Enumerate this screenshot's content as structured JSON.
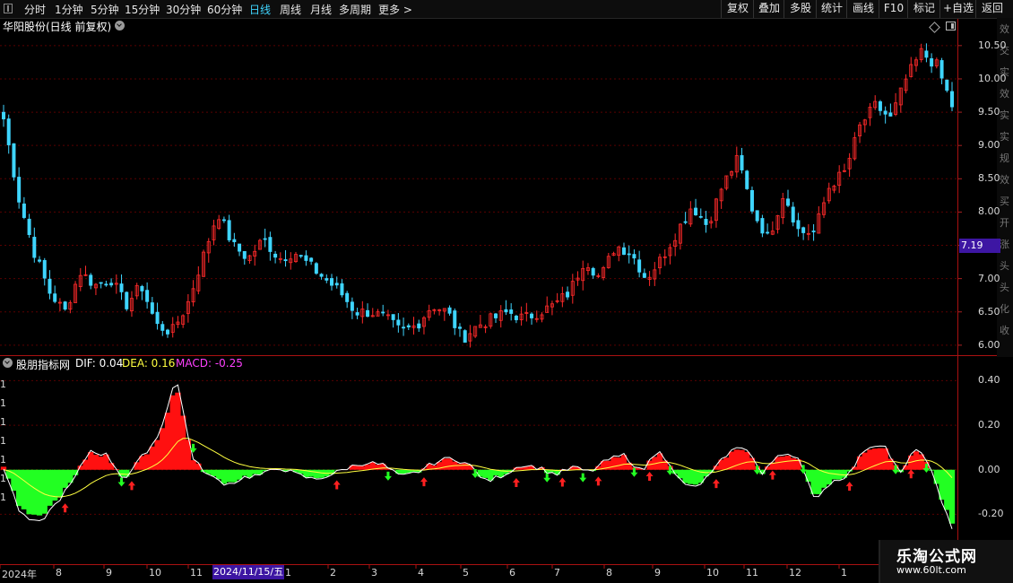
{
  "toolbar": {
    "periods": [
      "分时",
      "1分钟",
      "5分钟",
      "15分钟",
      "30分钟",
      "60分钟",
      "日线",
      "周线",
      "月线",
      "多周期",
      "更多 >"
    ],
    "active_period": "日线",
    "right_buttons": [
      "复权",
      "叠加",
      "多股",
      "统计",
      "画线",
      "F10",
      "标记",
      "+自选",
      "返回"
    ]
  },
  "stock": {
    "title": "华阳股份(日线 前复权)",
    "current_price_label": "7.19"
  },
  "price_axis": [
    "10.50",
    "10.00",
    "9.50",
    "9.00",
    "8.50",
    "8.00",
    "7.50",
    "7.00",
    "6.50",
    "6.00"
  ],
  "indicator": {
    "name": "股朋指标网",
    "dif": "DIF: 0.04",
    "dea": "DEA: 0.16",
    "macd": "MACD: -0.25",
    "axis": [
      "0.40",
      "0.20",
      "0.00",
      "-0.20"
    ],
    "side_ticks": [
      "1",
      "1",
      "1",
      "1",
      "1",
      "1",
      "1"
    ]
  },
  "sidebar_chars": [
    "效",
    "交",
    "实",
    "效",
    "实",
    "实",
    "规",
    "效",
    "买",
    "开",
    "涨",
    "头",
    "头",
    "化",
    "收"
  ],
  "time_axis": {
    "labels": [
      "2024年",
      "8",
      "9",
      "10",
      "11",
      "",
      "1",
      "2",
      "3",
      "4",
      "5",
      "6",
      "7",
      "8",
      "9",
      "10",
      "11",
      "12",
      "1"
    ],
    "cursor_date": "2024/11/15/五"
  },
  "watermark": {
    "title": "乐淘公式网",
    "url": "www.60lt.com"
  },
  "colors": {
    "up": "#ff2a2a",
    "down": "#3fd5ff",
    "macd_pos": "#ff1010",
    "macd_neg": "#22ff22",
    "dif_line": "#ffffff",
    "dea_line": "#ffff40",
    "grid": "#5a0000",
    "cursor_label": "#3d16a3"
  },
  "chart_data": [
    {
      "type": "candlestick",
      "title": "华阳股份(日线 前复权)",
      "ylim": [
        5.85,
        10.7
      ],
      "x_range": [
        "2024-07",
        "2025-01"
      ],
      "close_path": [
        [
          "2024-07",
          9.4
        ],
        [
          "2024-07",
          8.2
        ],
        [
          "2024-07",
          7.4
        ],
        [
          "2024-08",
          6.8
        ],
        [
          "2024-08",
          6.5
        ],
        [
          "2024-08",
          7.1
        ],
        [
          "2024-08",
          6.9
        ],
        [
          "2024-08",
          7.0
        ],
        [
          "2024-08",
          6.6
        ],
        [
          "2024-09",
          6.9
        ],
        [
          "2024-09",
          6.3
        ],
        [
          "2024-09",
          6.2
        ],
        [
          "2024-09",
          6.6
        ],
        [
          "2024-10",
          7.3
        ],
        [
          "2024-10",
          8.0
        ],
        [
          "2024-10",
          7.5
        ],
        [
          "2024-10",
          7.3
        ],
        [
          "2024-10",
          7.6
        ],
        [
          "2024-11",
          7.3
        ],
        [
          "2024-11",
          7.4
        ],
        [
          "2024-11",
          7.2
        ],
        [
          "2024-11",
          7.0
        ],
        [
          "2024-11",
          6.8
        ],
        [
          "2024-12",
          6.5
        ],
        [
          "2024-12",
          6.5
        ],
        [
          "2024-12",
          6.4
        ],
        [
          "2024-12",
          6.2
        ],
        [
          "2025-01",
          6.3
        ],
        [
          "2025-01",
          6.6
        ],
        [
          "2025-01",
          6.5
        ],
        [
          "2025-02",
          6.1
        ],
        [
          "2025-02",
          6.3
        ],
        [
          "2025-02",
          6.4
        ],
        [
          "2025-03",
          6.5
        ],
        [
          "2025-03",
          6.4
        ],
        [
          "2025-03",
          6.5
        ],
        [
          "2025-04",
          6.6
        ],
        [
          "2025-04",
          6.8
        ],
        [
          "2025-04",
          7.3
        ],
        [
          "2025-05",
          7.0
        ],
        [
          "2025-05",
          7.5
        ],
        [
          "2025-05",
          7.4
        ],
        [
          "2025-06",
          7.0
        ],
        [
          "2025-06",
          7.3
        ],
        [
          "2025-06",
          7.7
        ],
        [
          "2025-07",
          8.1
        ],
        [
          "2025-07",
          7.8
        ],
        [
          "2025-07",
          8.4
        ],
        [
          "2025-08",
          8.8
        ],
        [
          "2025-08",
          8.0
        ],
        [
          "2025-08",
          7.6
        ],
        [
          "2025-09",
          8.3
        ],
        [
          "2025-09",
          7.7
        ],
        [
          "2025-09",
          7.7
        ],
        [
          "2025-10",
          8.4
        ],
        [
          "2025-10",
          8.6
        ],
        [
          "2025-10",
          9.3
        ],
        [
          "2025-11",
          9.6
        ],
        [
          "2025-11",
          9.4
        ],
        [
          "2025-11",
          10.0
        ],
        [
          "2025-12",
          10.4
        ],
        [
          "2025-12",
          10.2
        ],
        [
          "2026-01",
          9.6
        ]
      ],
      "current_price": 7.19
    },
    {
      "type": "bar",
      "title": "股朋指标网 MACD",
      "ylim": [
        -0.42,
        0.45
      ],
      "values": [
        0.02,
        -0.18,
        -0.22,
        -0.14,
        -0.05,
        0.08,
        0.06,
        -0.04,
        0.05,
        0.14,
        0.38,
        0.04,
        -0.03,
        -0.06,
        -0.03,
        -0.02,
        0.01,
        -0.02,
        -0.04,
        -0.02,
        0.01,
        0.03,
        0.02,
        -0.03,
        -0.01,
        0.03,
        0.05,
        0.02,
        -0.05,
        -0.02,
        0.02,
        0.01,
        -0.02,
        0.01,
        -0.01,
        0.04,
        0.06,
        -0.01,
        0.09,
        -0.03,
        -0.08,
        -0.02,
        0.07,
        0.1,
        -0.02,
        0.07,
        0.06,
        -0.12,
        -0.05,
        -0.02,
        0.09,
        0.11,
        -0.02,
        0.1,
        -0.04,
        -0.25
      ],
      "series": [
        {
          "name": "DIF",
          "last": 0.04
        },
        {
          "name": "DEA",
          "last": 0.16
        },
        {
          "name": "MACD",
          "last": -0.25
        }
      ]
    }
  ]
}
